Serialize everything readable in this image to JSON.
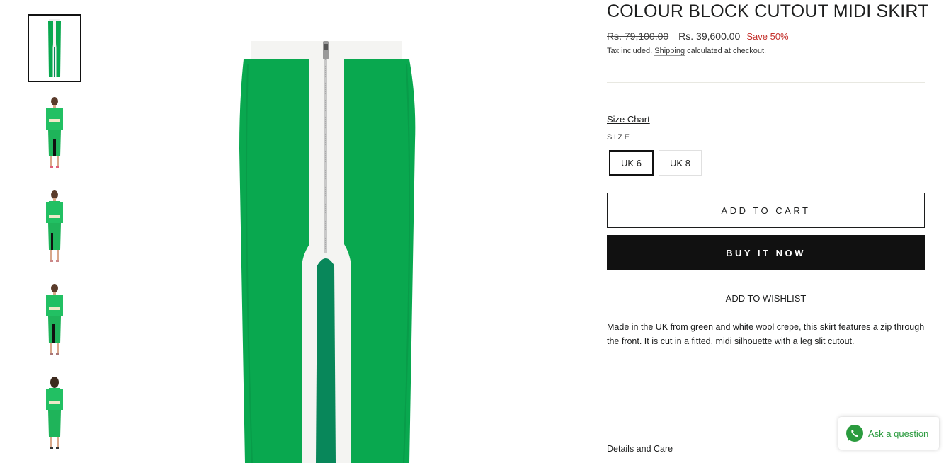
{
  "product": {
    "title": "COLOUR BLOCK CUTOUT MIDI SKIRT",
    "compare_price": "Rs. 79,100.00",
    "sale_price": "Rs. 39,600.00",
    "save_label": "Save 50%",
    "tax_prefix": "Tax included.",
    "shipping_link": "Shipping",
    "tax_suffix": "calculated at checkout.",
    "description": "Made in the UK from green and white wool crepe, this skirt features a zip through the front. It is cut in a fitted, midi silhouette with a leg slit cutout."
  },
  "size": {
    "chart_link": "Size Chart",
    "label": "SIZE",
    "options": [
      "UK 6",
      "UK 8"
    ],
    "selected": "UK 6"
  },
  "actions": {
    "add_to_cart": "ADD TO CART",
    "buy_now": "BUY IT NOW",
    "wishlist": "ADD TO WISHLIST"
  },
  "details_label": "Details and Care",
  "chat_widget": {
    "label": "Ask a question",
    "icon": "whatsapp-icon"
  },
  "colors": {
    "skirt_green": "#09a84f",
    "inner_green": "#08875a",
    "save_red": "#c4302b",
    "whatsapp_green": "#2a9b3e"
  }
}
